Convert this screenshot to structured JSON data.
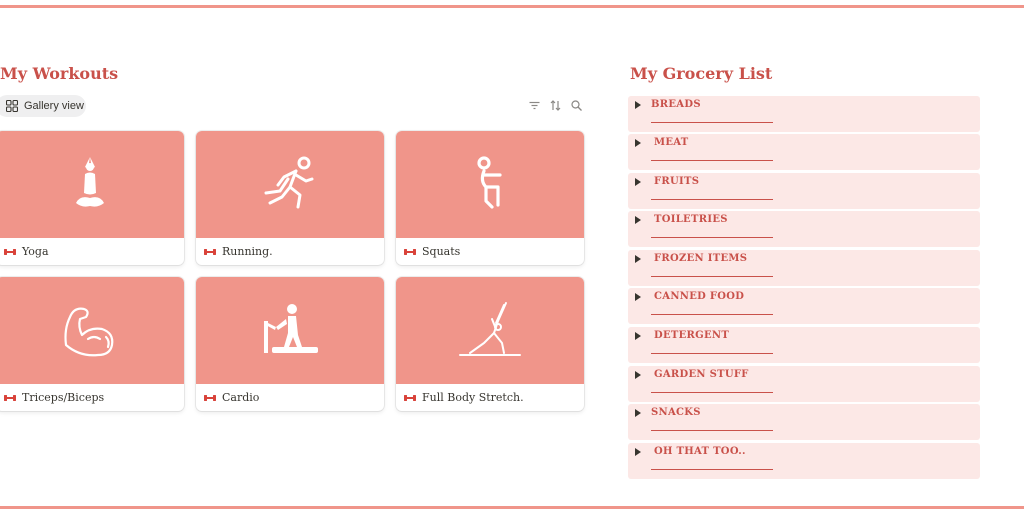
{
  "workouts": {
    "title": "My Workouts",
    "view_tab": "Gallery view",
    "tools": [
      "filter-icon",
      "sort-icon",
      "search-icon"
    ],
    "cards": [
      {
        "label": "Yoga",
        "icon": "yoga-pose-icon"
      },
      {
        "label": "Running.",
        "icon": "running-person-icon"
      },
      {
        "label": "Squats",
        "icon": "squat-person-icon"
      },
      {
        "label": "Triceps/Biceps",
        "icon": "flexed-arm-icon"
      },
      {
        "label": "Cardio",
        "icon": "treadmill-icon"
      },
      {
        "label": "Full Body Stretch.",
        "icon": "stretching-person-icon"
      }
    ]
  },
  "grocery": {
    "title": "My Grocery List",
    "items": [
      {
        "label": "BREADS"
      },
      {
        "label": "MEAT"
      },
      {
        "label": "FRUITS"
      },
      {
        "label": "TOILETRIES"
      },
      {
        "label": "FROZEN ITEMS"
      },
      {
        "label": "CANNED FOOD"
      },
      {
        "label": "DETERGENT"
      },
      {
        "label": "GARDEN STUFF"
      },
      {
        "label": "SNACKS"
      },
      {
        "label": "OH THAT TOO.."
      }
    ]
  },
  "colors": {
    "accent": "#c9514a",
    "cover": "#f0958a",
    "toggle_bg": "#fce8e6",
    "dumbbell": "#d9433a"
  }
}
